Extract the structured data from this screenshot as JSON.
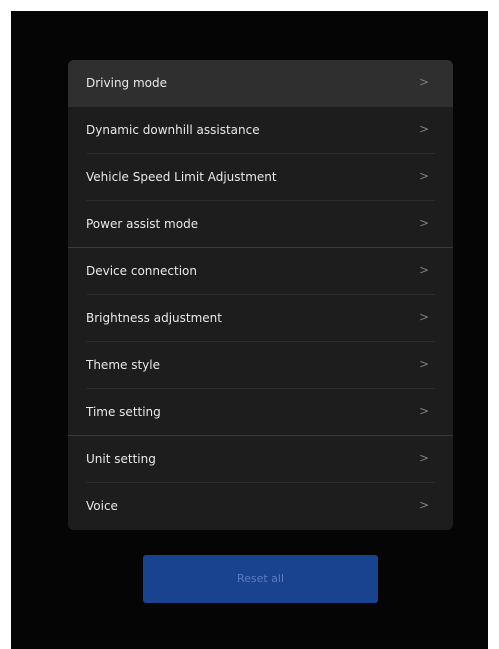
{
  "settings_menu": {
    "items": [
      {
        "label": "Driving mode",
        "chevron": ">"
      },
      {
        "label": "Dynamic downhill assistance",
        "chevron": ">"
      },
      {
        "label": "Vehicle Speed  Limit Adjustment",
        "chevron": ">"
      },
      {
        "label": "Power assist mode",
        "chevron": ">"
      },
      {
        "label": "Device connection",
        "chevron": ">"
      },
      {
        "label": "Brightness adjustment",
        "chevron": ">"
      },
      {
        "label": "Theme style",
        "chevron": ">"
      },
      {
        "label": "Time setting",
        "chevron": ">"
      },
      {
        "label": "Unit setting",
        "chevron": ">"
      },
      {
        "label": "Voice",
        "chevron": ">"
      }
    ],
    "selected_item": "Driving mode"
  },
  "reset_button": {
    "label": "Reset all"
  },
  "colors": {
    "screen_background": "#050505",
    "panel_background": "#1d1d1d",
    "selected_row": "#2f2f2f",
    "item_text": "#e9e9e9",
    "chevron": "#7d7d7d",
    "reset_button_background": "#19438e",
    "reset_button_text": "#5c7cc0"
  },
  "icons": {
    "chevron": "chevron-right-icon"
  }
}
